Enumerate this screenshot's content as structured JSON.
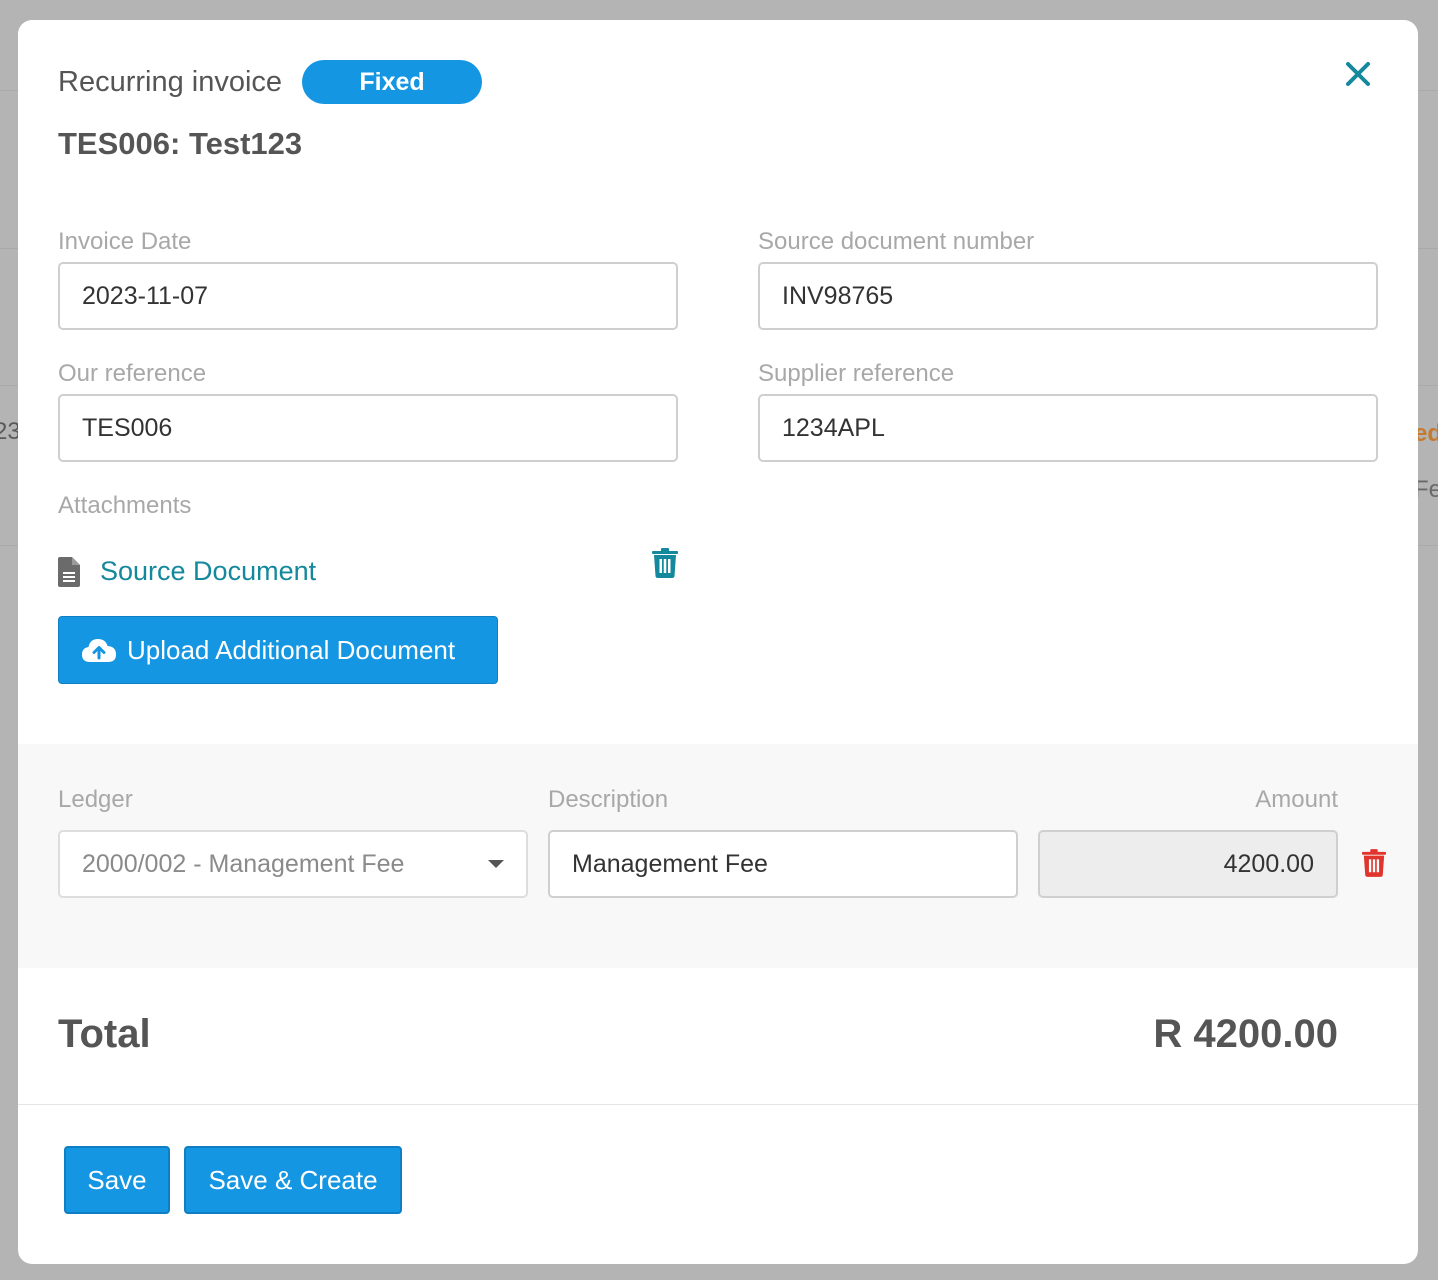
{
  "header": {
    "title": "Recurring invoice",
    "badge": "Fixed",
    "subtitle": "TES006: Test123"
  },
  "fields": {
    "invoice_date": {
      "label": "Invoice Date",
      "value": "2023-11-07"
    },
    "source_document_number": {
      "label": "Source document number",
      "value": "INV98765"
    },
    "our_reference": {
      "label": "Our reference",
      "value": "TES006"
    },
    "supplier_reference": {
      "label": "Supplier reference",
      "value": "1234APL"
    }
  },
  "attachments": {
    "label": "Attachments",
    "items": [
      {
        "name": "Source Document",
        "icon": "file-icon"
      }
    ],
    "upload_label": "Upload Additional Document"
  },
  "line_items": {
    "headers": {
      "ledger": "Ledger",
      "description": "Description",
      "amount": "Amount"
    },
    "rows": [
      {
        "ledger": "2000/002 - Management Fee",
        "description": "Management Fee",
        "amount": "4200.00"
      }
    ]
  },
  "total": {
    "label": "Total",
    "value": "R 4200.00"
  },
  "footer": {
    "save_label": "Save",
    "save_create_label": "Save & Create"
  },
  "colors": {
    "primary": "#1596e3",
    "link": "#14889c",
    "danger": "#e0342c"
  }
}
